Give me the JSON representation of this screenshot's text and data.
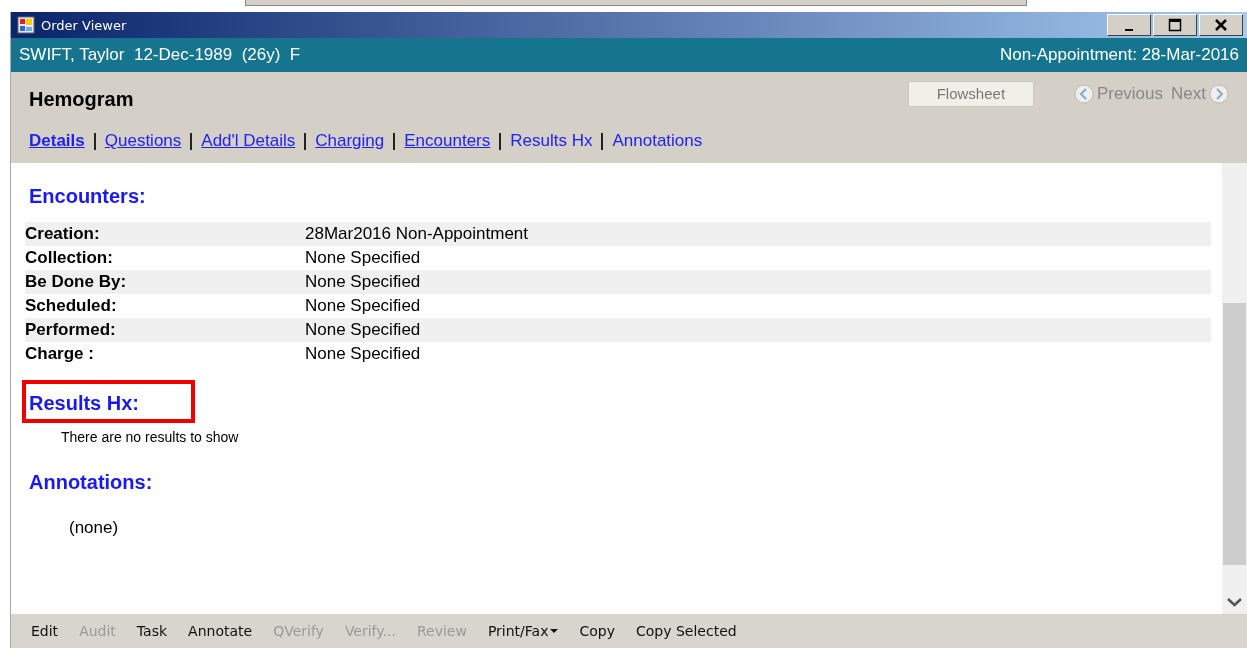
{
  "window": {
    "title": "Order Viewer"
  },
  "patient_bar": {
    "patient": "SWIFT, Taylor  12-Dec-1989  (26y)  F",
    "encounter": "Non-Appointment: 28-Mar-2016"
  },
  "order": {
    "title": "Hemogram",
    "flowsheet_button": "Flowsheet",
    "previous": "Previous",
    "next": "Next"
  },
  "nav_links": [
    {
      "label": "Details",
      "bold": true,
      "underlined": true
    },
    {
      "label": "Questions",
      "bold": false,
      "underlined": true
    },
    {
      "label": "Add'l Details",
      "bold": false,
      "underlined": true
    },
    {
      "label": "Charging",
      "bold": false,
      "underlined": true
    },
    {
      "label": "Encounters",
      "bold": false,
      "underlined": true
    },
    {
      "label": "Results Hx",
      "bold": false,
      "underlined": false
    },
    {
      "label": "Annotations",
      "bold": false,
      "underlined": false
    }
  ],
  "sections": [
    {
      "kind": "table",
      "heading": "Encounters:",
      "highlighted": false,
      "rows": [
        {
          "label": "Creation:",
          "value": "28Mar2016 Non-Appointment"
        },
        {
          "label": "Collection:",
          "value": "None Specified"
        },
        {
          "label": "Be Done By:",
          "value": "None Specified"
        },
        {
          "label": "Scheduled:",
          "value": "None Specified"
        },
        {
          "label": "Performed:",
          "value": "None Specified"
        },
        {
          "label": "Charge :",
          "value": "None Specified"
        }
      ]
    },
    {
      "kind": "note",
      "heading": "Results Hx:",
      "highlighted": true,
      "text": "There are no results to show"
    },
    {
      "kind": "plain",
      "heading": "Annotations:",
      "highlighted": false,
      "text": "(none)"
    }
  ],
  "toolbar": [
    {
      "label": "Edit",
      "disabled": false
    },
    {
      "label": "Audit",
      "disabled": true
    },
    {
      "label": "Task",
      "disabled": false
    },
    {
      "label": "Annotate",
      "disabled": false
    },
    {
      "label": "QVerify",
      "disabled": true
    },
    {
      "label": "Verify...",
      "disabled": true
    },
    {
      "label": "Review",
      "disabled": true
    },
    {
      "label": "Print/Fax",
      "disabled": false,
      "kind": "dropdown"
    },
    {
      "label": "Copy",
      "disabled": false
    },
    {
      "label": "Copy Selected",
      "disabled": false
    }
  ]
}
